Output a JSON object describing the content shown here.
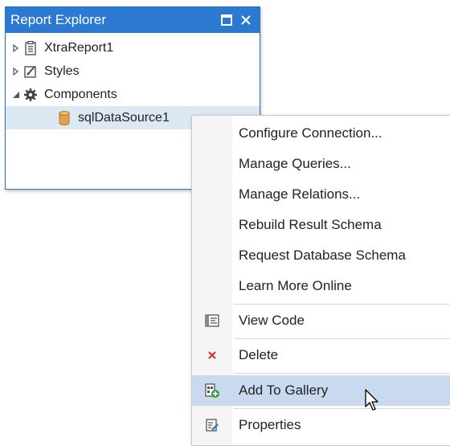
{
  "panel": {
    "title": "Report Explorer",
    "controls": {
      "maximize_icon": "maximize-icon",
      "close_icon": "close-icon"
    },
    "tree": [
      {
        "label": "XtraReport1",
        "icon": "report-icon",
        "expander": "collapsed"
      },
      {
        "label": "Styles",
        "icon": "styles-icon",
        "expander": "collapsed"
      },
      {
        "label": "Components",
        "icon": "gear-icon",
        "expander": "expanded"
      },
      {
        "label": "sqlDataSource1",
        "icon": "database-icon",
        "selected": true
      }
    ]
  },
  "context_menu": {
    "items": [
      {
        "label": "Configure Connection..."
      },
      {
        "label": "Manage Queries..."
      },
      {
        "label": "Manage Relations..."
      },
      {
        "label": "Rebuild Result Schema"
      },
      {
        "label": "Request Database Schema"
      },
      {
        "label": "Learn More Online"
      },
      {
        "label": "View Code",
        "icon": "view-code-icon"
      },
      {
        "label": "Delete",
        "icon": "delete-icon"
      },
      {
        "label": "Add To Gallery",
        "icon": "add-to-gallery-icon",
        "hovered": true
      },
      {
        "label": "Properties",
        "icon": "properties-icon"
      }
    ]
  },
  "colors": {
    "accent": "#2b79d0",
    "selection": "#dde8f5",
    "menu_hover": "#c9daf0"
  }
}
